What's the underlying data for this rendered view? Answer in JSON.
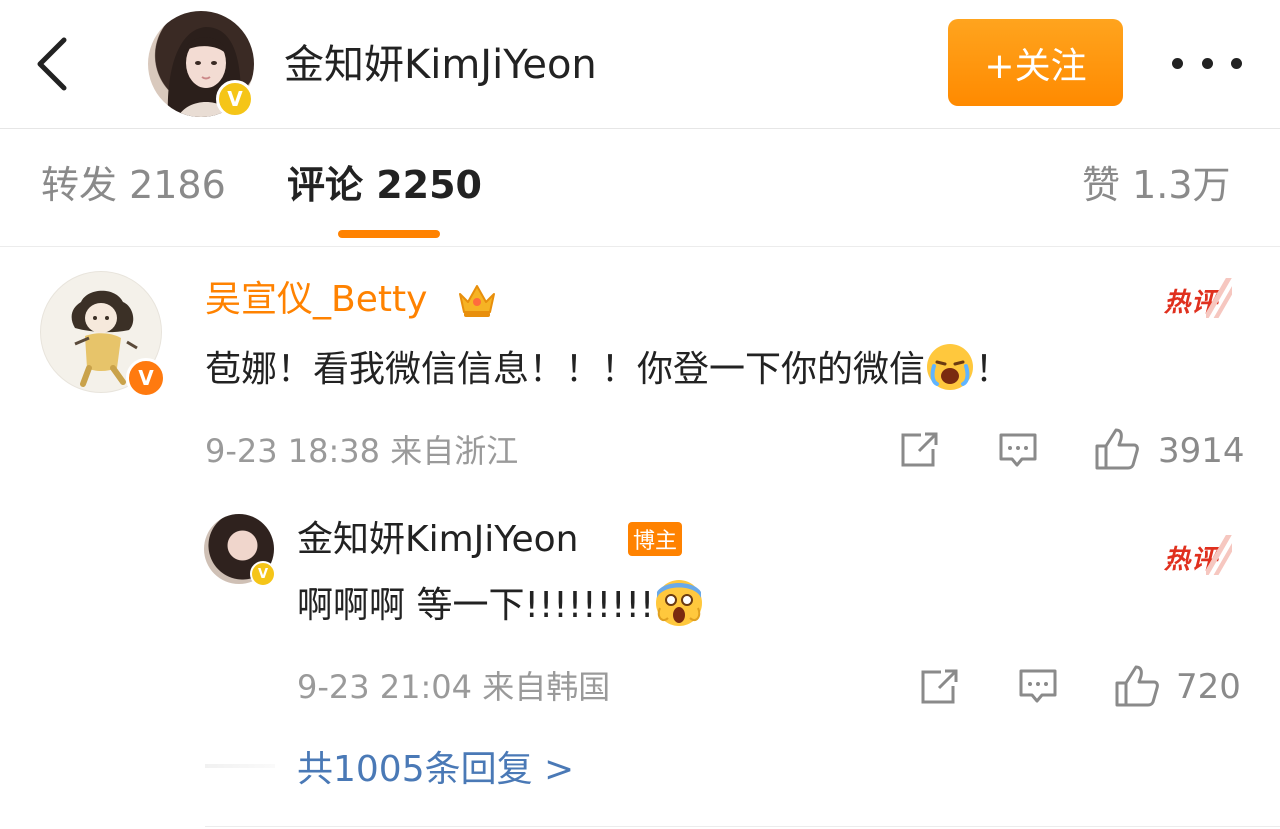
{
  "header": {
    "back_icon": "chevron-left-icon",
    "title": "金知妍KimJiYeon",
    "follow_label": "+关注",
    "more_icon": "more-horizontal-icon",
    "verified_icon": "verified-v-icon",
    "accent_color": "#ff8200"
  },
  "tabs": [
    {
      "label": "转发 2186",
      "active": false
    },
    {
      "label": "评论 2250",
      "active": true
    },
    {
      "label": "赞 1.3万",
      "active": false
    }
  ],
  "comment": {
    "username": "吴宣仪_Betty",
    "badge_icon": "crown-icon",
    "hot_label": "热评",
    "text_before": "苞娜！看我微信信息！！！你登一下你的微信",
    "emoji_icon": "crying-emoji-icon",
    "text_after": "！",
    "time": "9-23 18:38 来自浙江",
    "likes": "3914"
  },
  "reply": {
    "username": "金知妍KimJiYeon",
    "tag": "博主",
    "hot_label": "热评",
    "text": "啊啊啊 等一下!!!!!!!!!",
    "emoji_icon": "screaming-emoji-icon",
    "time": "9-23 21:04 来自韩国",
    "likes": "720"
  },
  "more_replies": "共1005条回复 >"
}
